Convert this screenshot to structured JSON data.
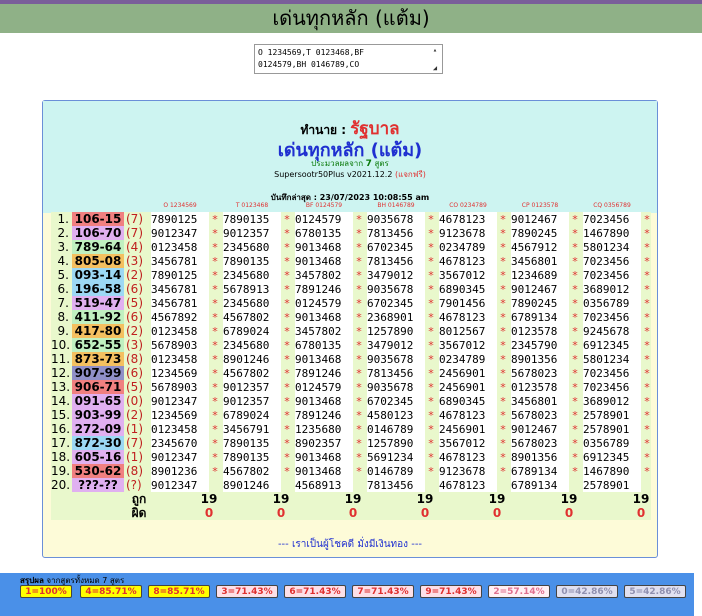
{
  "header": {
    "title": "เด่นทุกหลัก (แต้ม)"
  },
  "formula": {
    "value": "O 1234569,T 0123468,BF\n0124579,BH 0146789,CO"
  },
  "panel": {
    "predictor_prefix": "ทำนาย :",
    "predictor_name": "รัฐบาล",
    "title": "เด่นทุกหลัก (แต้ม)",
    "subtitle_pre": "ประมวลผลจาก",
    "subtitle_num": "7",
    "subtitle_post": "สูตร",
    "version": "Supersootr50Plus v2021.12.2",
    "version_tag": "(แจกฟรี)",
    "saved": "บันทึกล่าสุด : 23/07/2023 10:08:55 am",
    "motto": "--- เราเป็นผู้โชคดี มั่งมีเงินทอง ---"
  },
  "columns": [
    "O 1234569",
    "T 0123468",
    "BF 0124579",
    "BH 0146789",
    "CO 0234789",
    "CP 0123578",
    "CQ 0356789"
  ],
  "rows": [
    {
      "n": "1.",
      "pair": "106-15",
      "par": "(7)",
      "color": "#f08080",
      "cells": [
        "7890125",
        "7890135",
        "0124579",
        "9035678",
        "4678123",
        "9012467",
        "7023456"
      ]
    },
    {
      "n": "2.",
      "pair": "106-70",
      "par": "(7)",
      "color": "#e0b0f0",
      "cells": [
        "9012347",
        "9012357",
        "6780135",
        "7813456",
        "9123678",
        "7890245",
        "1467890"
      ]
    },
    {
      "n": "3.",
      "pair": "789-64",
      "par": "(4)",
      "color": "#c0f0c0",
      "cells": [
        "0123458",
        "2345680",
        "9013468",
        "6702345",
        "0234789",
        "4567912",
        "5801234"
      ]
    },
    {
      "n": "4.",
      "pair": "805-08",
      "par": "(3)",
      "color": "#f4c060",
      "cells": [
        "3456781",
        "7890135",
        "9013468",
        "7813456",
        "4678123",
        "3456801",
        "7023456"
      ]
    },
    {
      "n": "5.",
      "pair": "093-14",
      "par": "(2)",
      "color": "#9cd8f4",
      "cells": [
        "7890125",
        "2345680",
        "3457802",
        "3479012",
        "3567012",
        "1234689",
        "7023456"
      ]
    },
    {
      "n": "6.",
      "pair": "196-58",
      "par": "(6)",
      "color": "#9cd8f4",
      "cells": [
        "3456781",
        "5678913",
        "7891246",
        "9035678",
        "6890345",
        "9012467",
        "3689012"
      ]
    },
    {
      "n": "7.",
      "pair": "519-47",
      "par": "(5)",
      "color": "#e0b0f0",
      "cells": [
        "3456781",
        "2345680",
        "0124579",
        "6702345",
        "7901456",
        "7890245",
        "0356789"
      ]
    },
    {
      "n": "8.",
      "pair": "411-92",
      "par": "(6)",
      "color": "#c0f0c0",
      "cells": [
        "4567892",
        "4567802",
        "9013468",
        "2368901",
        "4678123",
        "6789134",
        "7023456"
      ]
    },
    {
      "n": "9.",
      "pair": "417-80",
      "par": "(2)",
      "color": "#f4c060",
      "cells": [
        "0123458",
        "6789024",
        "3457802",
        "1257890",
        "8012567",
        "0123578",
        "9245678"
      ]
    },
    {
      "n": "10.",
      "pair": "652-55",
      "par": "(3)",
      "color": "#c0f0c0",
      "cells": [
        "5678903",
        "2345680",
        "6780135",
        "3479012",
        "3567012",
        "2345790",
        "6912345"
      ]
    },
    {
      "n": "11.",
      "pair": "873-73",
      "par": "(8)",
      "color": "#f4c060",
      "cells": [
        "0123458",
        "8901246",
        "9013468",
        "9035678",
        "0234789",
        "8901356",
        "5801234"
      ]
    },
    {
      "n": "12.",
      "pair": "907-99",
      "par": "(6)",
      "color": "#9090c8",
      "cells": [
        "1234569",
        "4567802",
        "7891246",
        "7813456",
        "2456901",
        "5678023",
        "7023456"
      ]
    },
    {
      "n": "13.",
      "pair": "906-71",
      "par": "(5)",
      "color": "#f08080",
      "cells": [
        "5678903",
        "9012357",
        "0124579",
        "9035678",
        "2456901",
        "0123578",
        "7023456"
      ]
    },
    {
      "n": "14.",
      "pair": "091-65",
      "par": "(0)",
      "color": "#e0b0f0",
      "cells": [
        "9012347",
        "9012357",
        "9013468",
        "6702345",
        "6890345",
        "3456801",
        "3689012"
      ]
    },
    {
      "n": "15.",
      "pair": "903-99",
      "par": "(2)",
      "color": "#e0b0f0",
      "cells": [
        "1234569",
        "6789024",
        "7891246",
        "4580123",
        "4678123",
        "5678023",
        "2578901"
      ]
    },
    {
      "n": "16.",
      "pair": "272-09",
      "par": "(1)",
      "color": "#e0b0f0",
      "cells": [
        "0123458",
        "3456791",
        "1235680",
        "0146789",
        "2456901",
        "9012467",
        "2578901"
      ]
    },
    {
      "n": "17.",
      "pair": "872-30",
      "par": "(7)",
      "color": "#9cd8f4",
      "cells": [
        "2345670",
        "7890135",
        "8902357",
        "1257890",
        "3567012",
        "5678023",
        "0356789"
      ]
    },
    {
      "n": "18.",
      "pair": "605-16",
      "par": "(1)",
      "color": "#e0b0f0",
      "cells": [
        "9012347",
        "7890135",
        "9013468",
        "5691234",
        "4678123",
        "8901356",
        "6912345"
      ]
    },
    {
      "n": "19.",
      "pair": "530-62",
      "par": "(8)",
      "color": "#f08080",
      "cells": [
        "8901236",
        "4567802",
        "9013468",
        "0146789",
        "9123678",
        "6789134",
        "1467890"
      ]
    },
    {
      "n": "20.",
      "pair": "???-??",
      "par": "(?)",
      "color": "#e0b0f0",
      "cells": [
        "9012347",
        "8901246",
        "4568913",
        "7813456",
        "4678123",
        "6789134",
        "2578901"
      ]
    }
  ],
  "footer": {
    "hit_label": "ถูก",
    "miss_label": "ผิด",
    "hits": [
      "19",
      "19",
      "19",
      "19",
      "19",
      "19",
      "19"
    ],
    "misses": [
      "0",
      "0",
      "0",
      "0",
      "0",
      "0",
      "0"
    ]
  },
  "summary": {
    "title_bold": "สรุปผล",
    "title_rest": "จากสูตรทั้งหมด 7 สูตร",
    "pills": [
      {
        "label": "1=100%",
        "bg": "#ffff00",
        "fg": "#e03030"
      },
      {
        "label": "4=85.71%",
        "bg": "#ffff00",
        "fg": "#e03030"
      },
      {
        "label": "8=85.71%",
        "bg": "#ffff00",
        "fg": "#e03030"
      },
      {
        "label": "3=71.43%",
        "bg": "#fde0e8",
        "fg": "#e03030"
      },
      {
        "label": "6=71.43%",
        "bg": "#fde0e8",
        "fg": "#e03030"
      },
      {
        "label": "7=71.43%",
        "bg": "#fde0e8",
        "fg": "#e03030"
      },
      {
        "label": "9=71.43%",
        "bg": "#fde0e8",
        "fg": "#e03030"
      },
      {
        "label": "2=57.14%",
        "bg": "#fff0f4",
        "fg": "#e07090"
      },
      {
        "label": "0=42.86%",
        "bg": "#e0e0f0",
        "fg": "#9090b0"
      },
      {
        "label": "5=42.86%",
        "bg": "#e0e0f0",
        "fg": "#9090b0"
      }
    ]
  }
}
